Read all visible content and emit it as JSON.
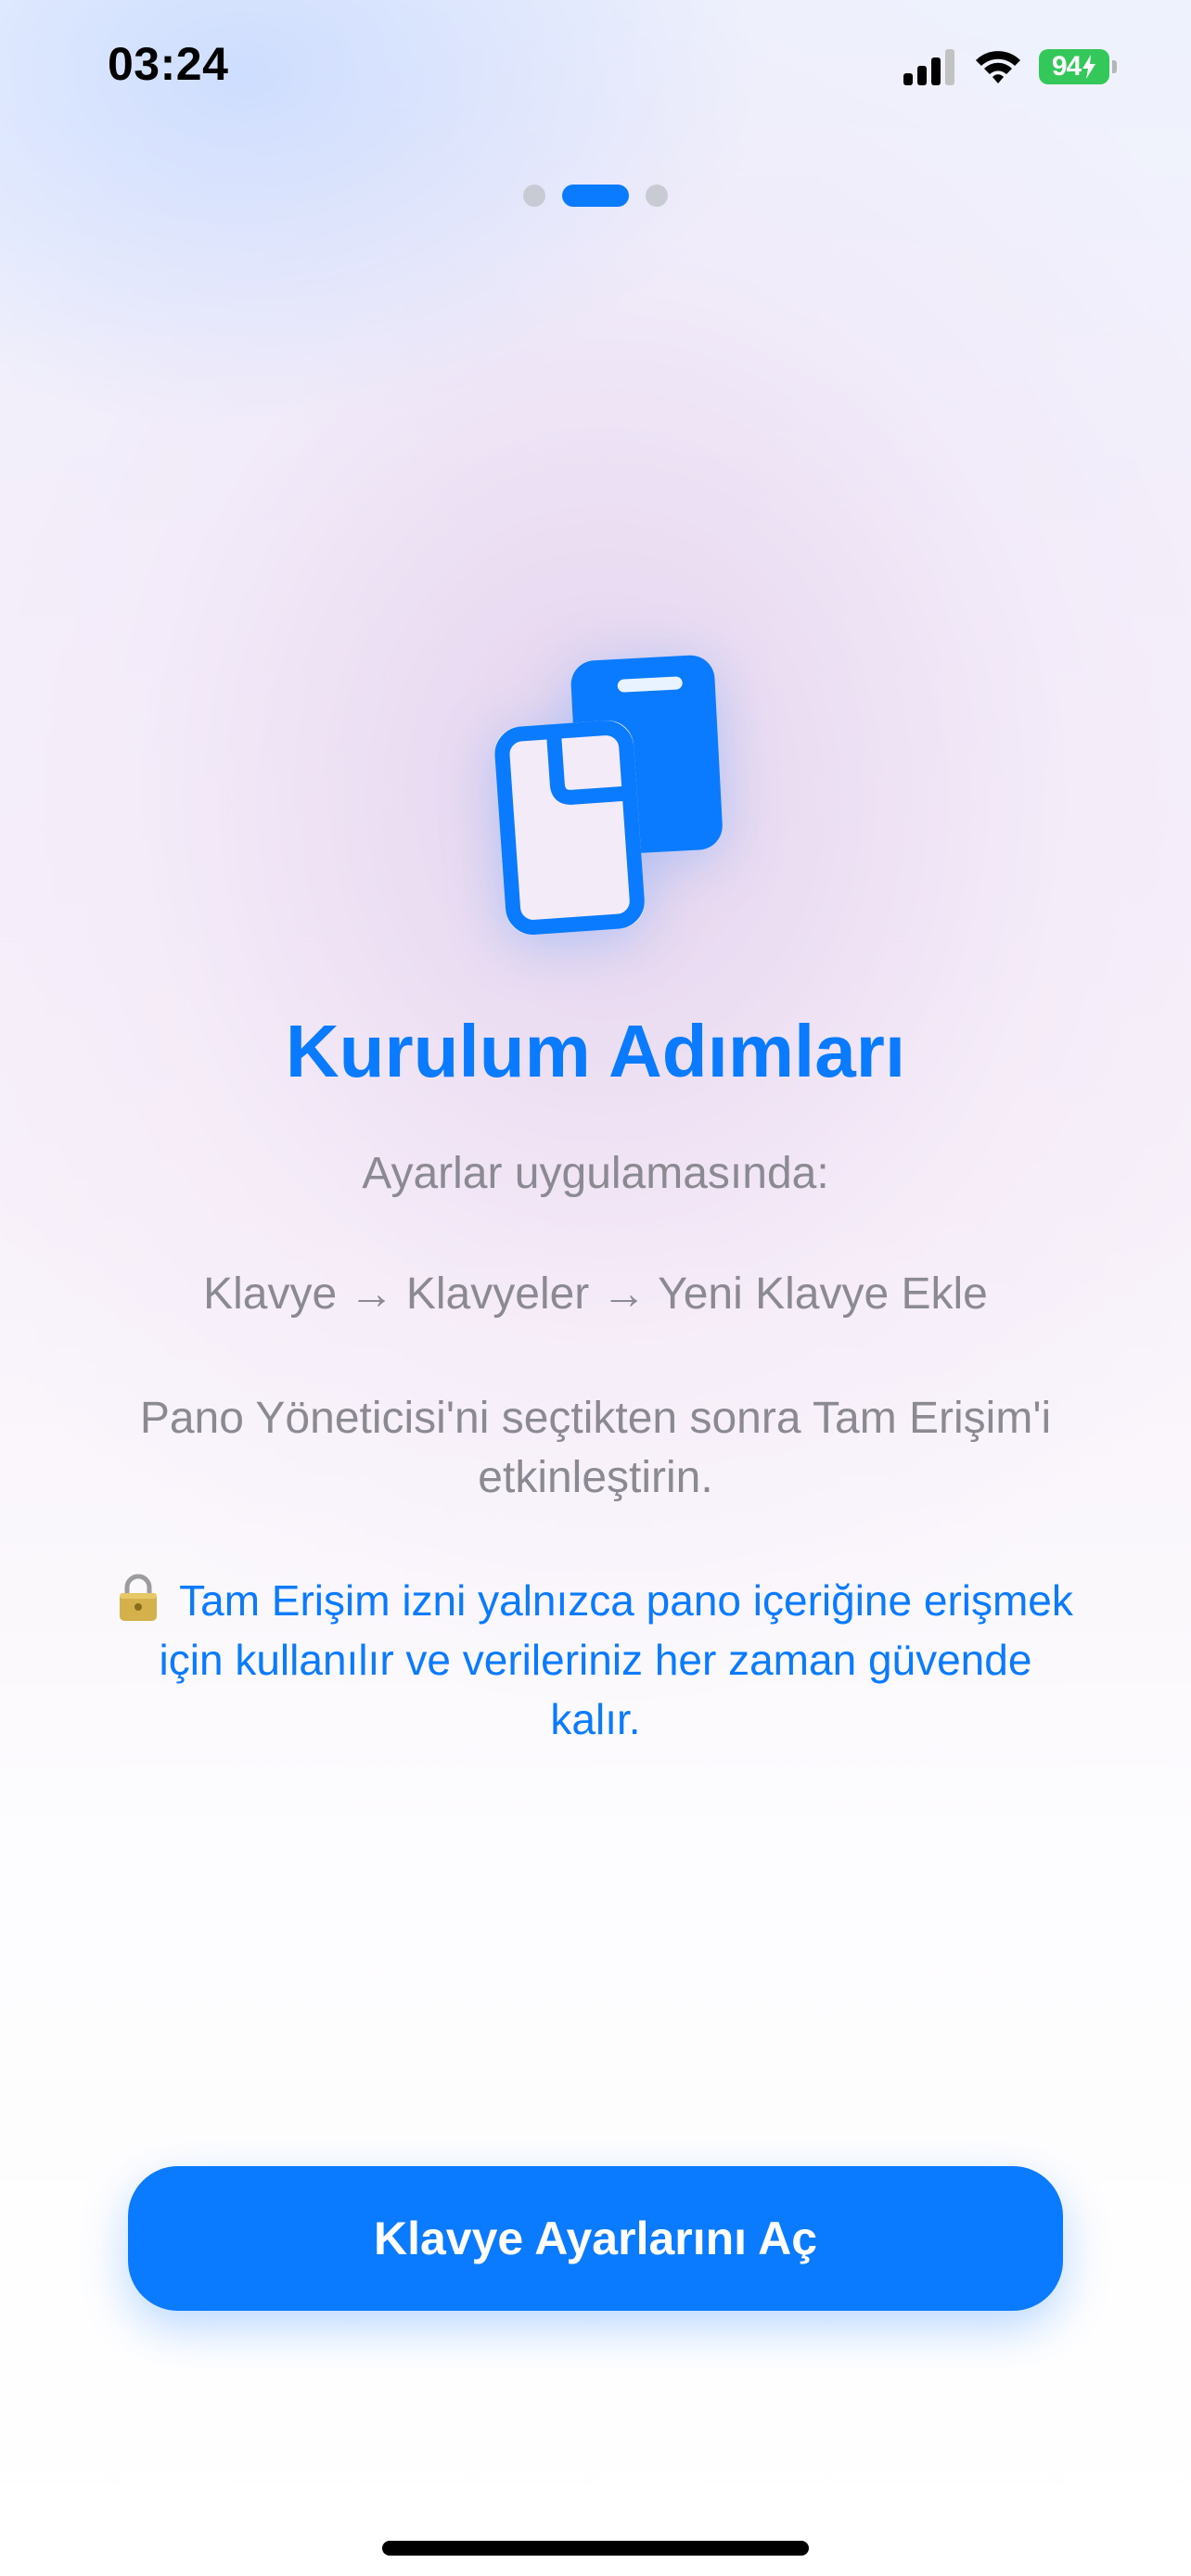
{
  "status_bar": {
    "time": "03:24",
    "battery_level": "94",
    "icons": [
      "cellular-signal-icon",
      "wifi-icon",
      "battery-charging-icon"
    ]
  },
  "page_indicator": {
    "count": 3,
    "active_index": 1
  },
  "hero": {
    "icon": "clipboard-stack-icon"
  },
  "content": {
    "title": "Kurulum Adımları",
    "subtitle": "Ayarlar uygulamasında:",
    "path": "Klavye → Klavyeler → Yeni Klavye Ekle",
    "instruction": "Pano Yöneticisi'ni seçtikten sonra Tam Erişim'i etkinleştirin.",
    "note_icon": "lock-icon",
    "note": "Tam Erişim izni yalnızca pano içeriğine erişmek için kullanılır ve verileriniz her zaman güvende kalır."
  },
  "actions": {
    "open_keyboard_settings": "Klavye Ayarlarını Aç"
  },
  "colors": {
    "accent": "#0A7AFF",
    "secondary_text": "#8B8A92",
    "battery": "#34C759"
  }
}
